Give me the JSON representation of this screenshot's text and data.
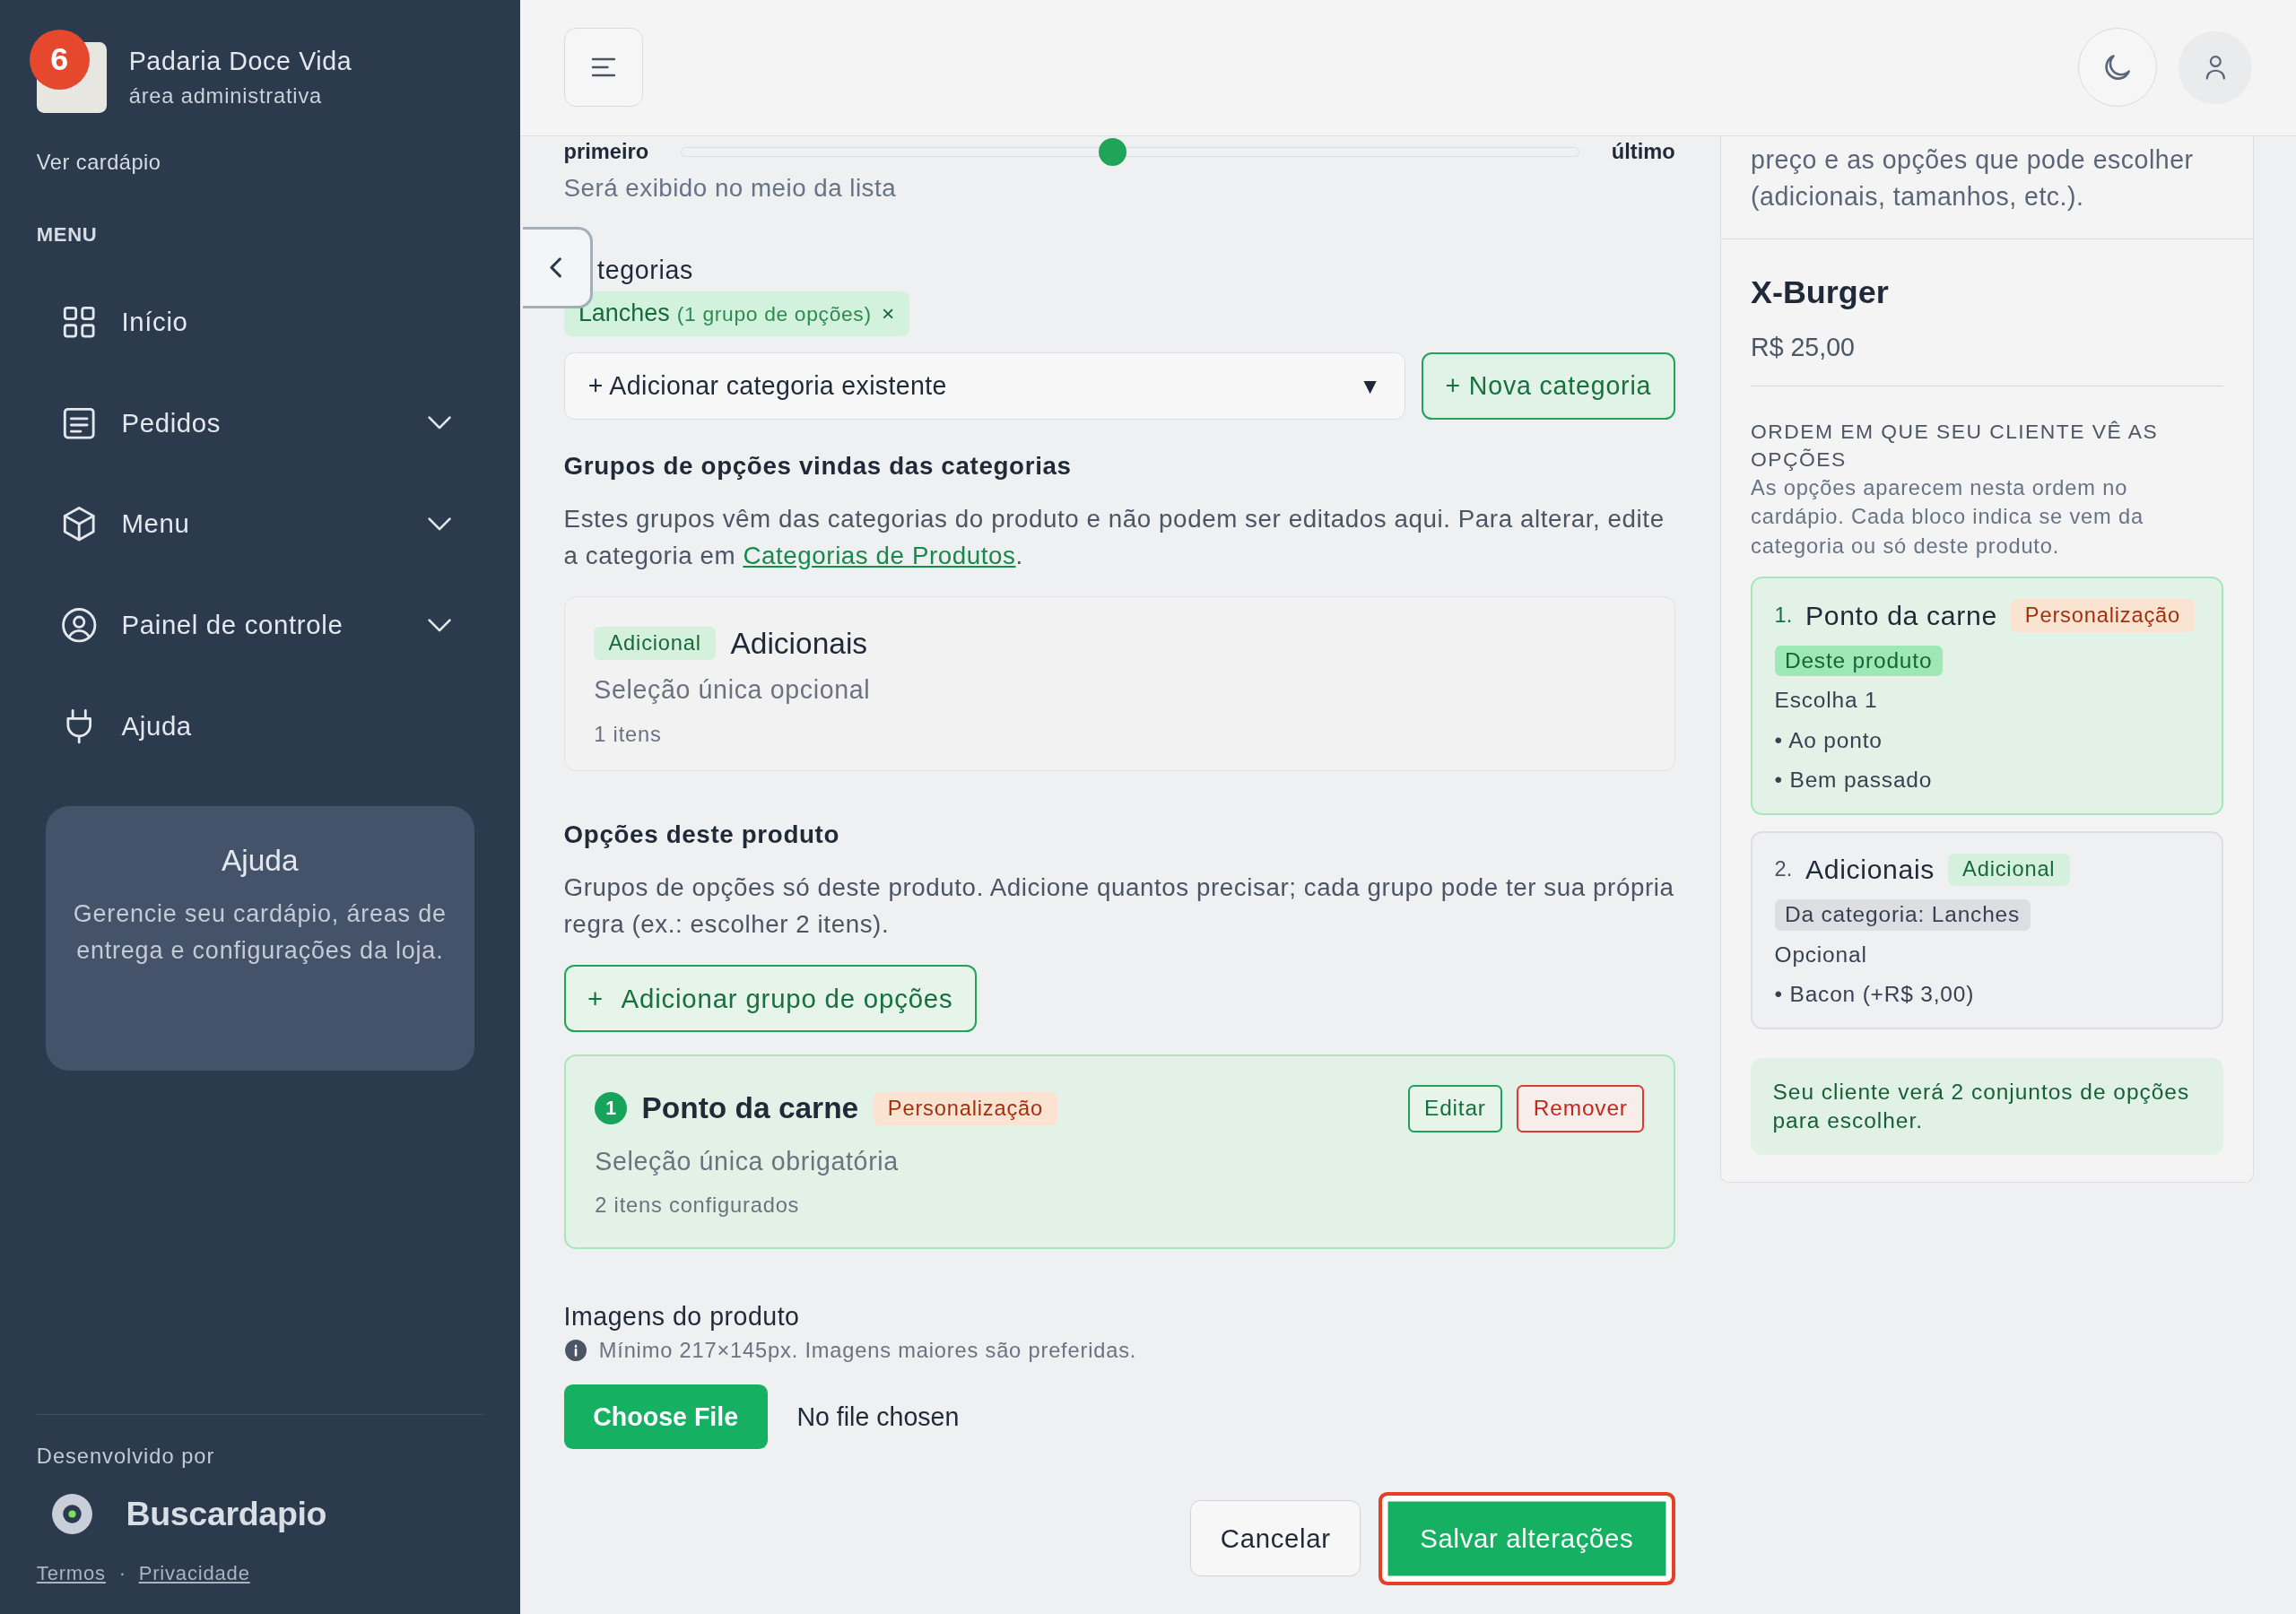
{
  "sidebar": {
    "store_name": "Padaria Doce Vida",
    "store_subtitle": "área administrativa",
    "notification_count": "6",
    "menu_link": "Ver cardápio",
    "section_title": "MENU",
    "items": [
      {
        "label": "Início",
        "kind": "grid",
        "expandable": false
      },
      {
        "label": "Pedidos",
        "kind": "list",
        "expandable": true
      },
      {
        "label": "Menu",
        "kind": "box",
        "expandable": true
      },
      {
        "label": "Painel de controle",
        "kind": "user",
        "expandable": true
      },
      {
        "label": "Ajuda",
        "kind": "plug",
        "expandable": false
      }
    ],
    "help_card": {
      "title": "Ajuda",
      "text": "Gerencie seu cardápio, áreas de entrega e configurações da loja."
    },
    "footer": {
      "credit": "Desenvolvido por",
      "brand": "Buscardapio",
      "links": [
        "Termos",
        "Privacidade"
      ],
      "separator": "·"
    }
  },
  "position": {
    "start_label": "primeiro",
    "end_label": "último",
    "level": 0.48,
    "hint": "Será exibido no meio da lista"
  },
  "categories": {
    "label": "tegorias",
    "chips": [
      {
        "name": "Lanches",
        "detail": "(1 grupo de opções)",
        "remove": "×"
      }
    ],
    "select": {
      "value": "+ Adicionar categoria existente",
      "caret": "▼"
    },
    "new_button": "+ Nova categoria"
  },
  "inherited_groups": {
    "heading": "Grupos de opções vindas das categorias",
    "text_before": "Estes grupos vêm das categorias do produto e não podem ser editados aqui. Para alterar, edite a categoria em ",
    "link": "Categorias de Produtos",
    "text_after": ".",
    "groups": [
      {
        "tag": {
          "text": "Adicional",
          "kind": "addon"
        },
        "name": "Adicionais",
        "rule": "Seleção única opcional",
        "count": "1 itens"
      }
    ]
  },
  "product_groups": {
    "heading": "Opções deste produto",
    "text": "Grupos de opções só deste produto. Adicione quantos precisar; cada grupo pode ter sua própria regra (ex.: escolher 2 itens).",
    "add_button": {
      "icon": "+",
      "label": "Adicionar grupo de opções"
    },
    "groups": [
      {
        "number": "1",
        "name": "Ponto da carne",
        "tag": {
          "text": "Personalização",
          "kind": "custom"
        },
        "actions": [
          {
            "label": "Editar",
            "kind": "edit"
          },
          {
            "label": "Remover",
            "kind": "remove"
          }
        ],
        "rule": "Seleção única obrigatória",
        "count": "2 itens configurados"
      }
    ]
  },
  "images": {
    "label": "Imagens do produto",
    "hint": "Mínimo 217×145px. Imagens maiores são preferidas.",
    "file_button": "Choose File",
    "file_status": "No file chosen"
  },
  "actions": [
    {
      "label": "Cancelar",
      "kind": "secondary",
      "highlighted": false
    },
    {
      "label": "Salvar alterações",
      "kind": "primary",
      "highlighted": true
    }
  ],
  "preview": {
    "intro": "preço e as opções que pode escolher (adicionais, tamanhos, etc.).",
    "product_name": "X-Burger",
    "price": "R$ 25,00",
    "order_title": "ORDEM EM QUE SEU CLIENTE VÊ AS OPÇÕES",
    "order_text": "As opções aparecem nesta ordem no cardápio. Cada bloco indica se vem da categoria ou só deste produto.",
    "groups": [
      {
        "number": "1.",
        "name": "Ponto da carne",
        "tag": {
          "text": "Personalização",
          "kind": "custom"
        },
        "source": {
          "text": "Deste produto",
          "kind": "product"
        },
        "rule": "Escolha 1",
        "options": [
          "• Ao ponto",
          "• Bem passado"
        ]
      },
      {
        "number": "2.",
        "name": "Adicionais",
        "tag": {
          "text": "Adicional",
          "kind": "addon"
        },
        "source": {
          "text": "Da categoria: Lanches",
          "kind": "category"
        },
        "rule": "Opcional",
        "options": [
          "• Bacon (+R$ 3,00)"
        ]
      }
    ],
    "summary": "Seu cliente verá 2 conjuntos de opções para escolher."
  }
}
